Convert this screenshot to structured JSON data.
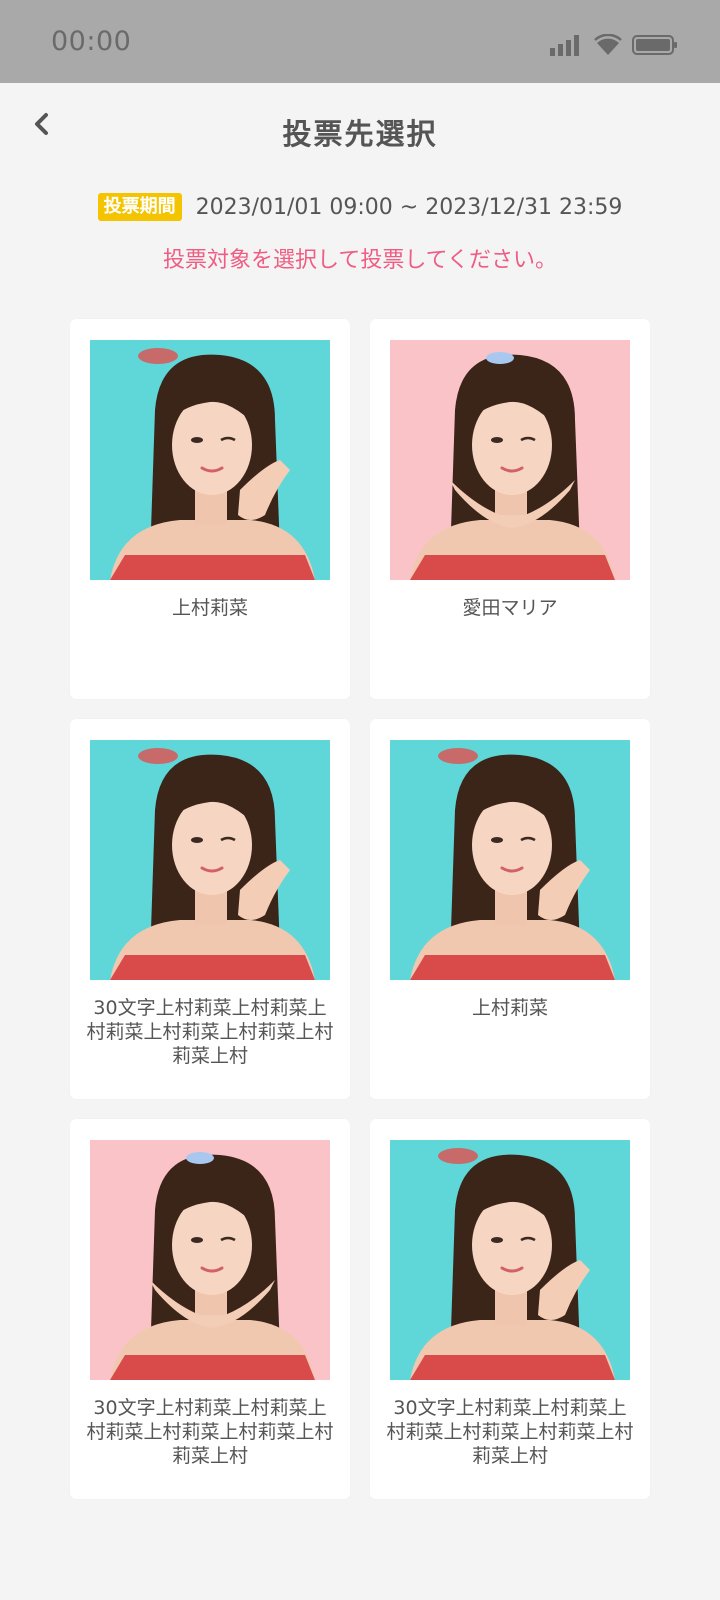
{
  "status_bar": {
    "time": "00:00"
  },
  "header": {
    "title": "投票先選択"
  },
  "period": {
    "badge": "投票期間",
    "range": "2023/01/01 09:00 ~ 2023/12/31 23:59"
  },
  "instruction": "投票対象を選択して投票してください。",
  "colors": {
    "accent_pink": "#ef5d82",
    "badge_yellow": "#f5c400",
    "teal_bg": "#5fd6d8",
    "pink_bg": "#fac3c8"
  },
  "candidates": [
    {
      "name": "上村莉菜",
      "photo": "teal"
    },
    {
      "name": "愛田マリア",
      "photo": "pink"
    },
    {
      "name": "30文字上村莉菜上村莉菜上村莉菜上村莉菜上村莉菜上村莉菜上村",
      "photo": "teal"
    },
    {
      "name": "上村莉菜",
      "photo": "teal"
    },
    {
      "name": "30文字上村莉菜上村莉菜上村莉菜上村莉菜上村莉菜上村莉菜上村",
      "photo": "pink"
    },
    {
      "name": "30文字上村莉菜上村莉菜上村莉菜上村莉菜上村莉菜上村莉菜上村",
      "photo": "teal"
    }
  ]
}
